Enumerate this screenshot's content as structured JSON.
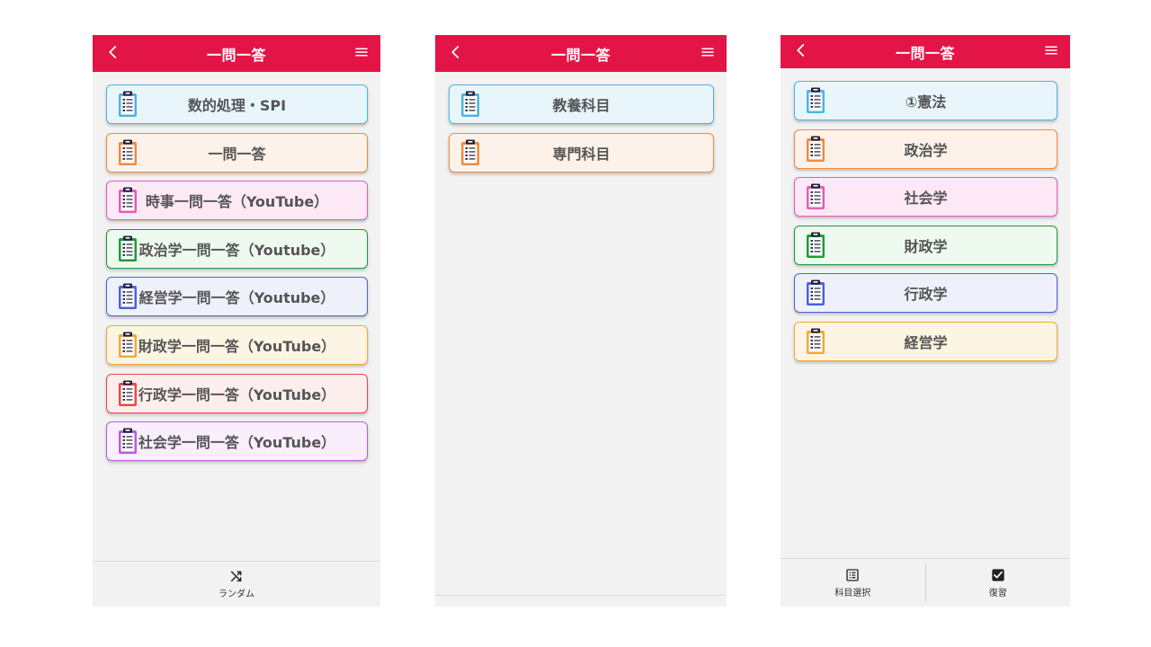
{
  "screens": [
    {
      "title": "一問一答",
      "cards": [
        {
          "label": "数的処理・SPI",
          "color": "#4fb3e0",
          "bg": "#e8f6fc"
        },
        {
          "label": "一問一答",
          "color": "#ef8a3e",
          "bg": "#fdf2ea"
        },
        {
          "label": "時事一問一答（YouTube）",
          "color": "#e45bbd",
          "bg": "#fde9f6"
        },
        {
          "label": "政治学一問一答（Youtube）",
          "color": "#1f9a3b",
          "bg": "#eefaf0"
        },
        {
          "label": "経営学一問一答（Youtube）",
          "color": "#4a63d8",
          "bg": "#eef1fb"
        },
        {
          "label": "財政学一問一答（YouTube）",
          "color": "#eeaa3a",
          "bg": "#fdf5e3"
        },
        {
          "label": "行政学一問一答（YouTube）",
          "color": "#e84a4a",
          "bg": "#fdeeee"
        },
        {
          "label": "社会学一問一答（YouTube）",
          "color": "#b45fd6",
          "bg": "#f9eefc"
        }
      ],
      "footer": [
        {
          "label": "ランダム",
          "icon": "shuffle-icon"
        }
      ]
    },
    {
      "title": "一問一答",
      "cards": [
        {
          "label": "教養科目",
          "color": "#4fb3e0",
          "bg": "#e8f6fc"
        },
        {
          "label": "専門科目",
          "color": "#ef8a3e",
          "bg": "#fdf2ea"
        }
      ],
      "footer": []
    },
    {
      "title": "一問一答",
      "cards": [
        {
          "label": "①憲法",
          "color": "#4fb3e0",
          "bg": "#e8f6fc"
        },
        {
          "label": "政治学",
          "color": "#ef8a3e",
          "bg": "#fdf2ea"
        },
        {
          "label": "社会学",
          "color": "#e45bbd",
          "bg": "#fde9f6"
        },
        {
          "label": "財政学",
          "color": "#1f9a3b",
          "bg": "#eefaf0"
        },
        {
          "label": "行政学",
          "color": "#4a63d8",
          "bg": "#eef1fb"
        },
        {
          "label": "経営学",
          "color": "#eeaa3a",
          "bg": "#fdf5e3"
        }
      ],
      "footer": [
        {
          "label": "科目選択",
          "icon": "list-icon"
        },
        {
          "label": "復習",
          "icon": "checkbox-icon"
        }
      ]
    }
  ],
  "colors": {
    "header": "#e31446",
    "background": "#f2f2f2"
  }
}
